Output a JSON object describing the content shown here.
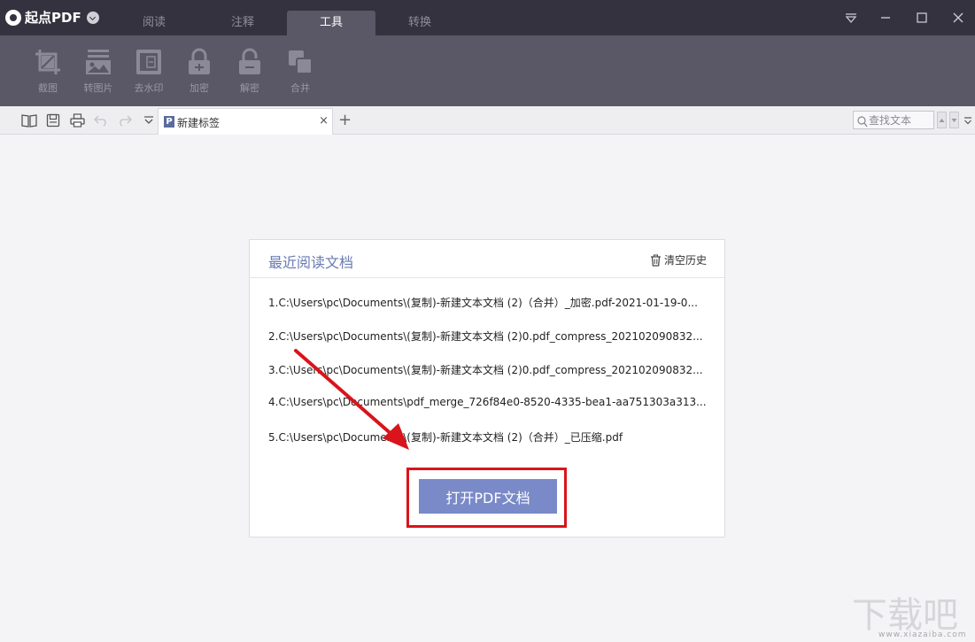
{
  "app": {
    "name": "起点PDF",
    "colors": {
      "titlebar": "#35323f",
      "toolbar": "#5a5766",
      "accent": "#7a8ac8",
      "highlight": "#d9141b"
    }
  },
  "main_tabs": [
    {
      "label": "阅读",
      "active": false
    },
    {
      "label": "注释",
      "active": false
    },
    {
      "label": "工具",
      "active": true
    },
    {
      "label": "转换",
      "active": false
    }
  ],
  "window_controls": [
    "dropdown-icon",
    "minimize-icon",
    "maximize-icon",
    "close-icon"
  ],
  "tools": [
    {
      "label": "截图",
      "icon": "crop-icon"
    },
    {
      "label": "转图片",
      "icon": "image-convert-icon"
    },
    {
      "label": "去水印",
      "icon": "watermark-remove-icon"
    },
    {
      "label": "加密",
      "icon": "lock-icon"
    },
    {
      "label": "解密",
      "icon": "unlock-icon"
    },
    {
      "label": "合并",
      "icon": "merge-icon"
    }
  ],
  "quick_toolbar": [
    "open-book-icon",
    "save-icon",
    "print-icon",
    "undo-icon",
    "redo-icon",
    "chevron-down-icon"
  ],
  "doc_tab": {
    "icon_letter": "P",
    "title": "新建标签",
    "close": "×",
    "new_tab": "+"
  },
  "search": {
    "placeholder": "查找文本"
  },
  "recent": {
    "title": "最近阅读文档",
    "clear_label": "清空历史",
    "items": [
      "1.C:\\Users\\pc\\Documents\\(复制)-新建文本文档 (2)（合并）_加密.pdf-2021-01-19-0...",
      "2.C:\\Users\\pc\\Documents\\(复制)-新建文本文档 (2)0.pdf_compress_202102090832...",
      "3.C:\\Users\\pc\\Documents\\(复制)-新建文本文档 (2)0.pdf_compress_202102090832...",
      "4.C:\\Users\\pc\\Documents\\pdf_merge_726f84e0-8520-4335-bea1-aa751303a313...",
      "5.C:\\Users\\pc\\Documents\\(复制)-新建文本文档 (2)（合并）_已压缩.pdf"
    ],
    "open_button": "打开PDF文档"
  },
  "watermark": {
    "text": "下载吧",
    "url": "www.xiazaiba.com"
  }
}
